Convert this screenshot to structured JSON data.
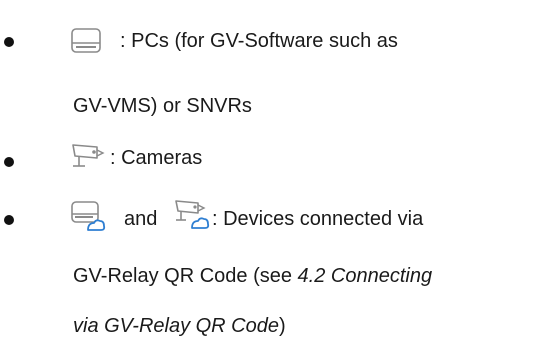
{
  "items": [
    {
      "icons": [
        "pc-icon"
      ],
      "lines": [
        ": PCs (for GV-Software such as",
        "GV-VMS) or SNVRs"
      ]
    },
    {
      "icons": [
        "camera-icon"
      ],
      "lines": [
        ": Cameras"
      ]
    },
    {
      "icons": [
        "pc-relay-icon",
        "camera-relay-icon"
      ],
      "connector": "and",
      "lines": [
        ": Devices connected via",
        "GV-Relay QR Code (see ",
        "4.2 Connecting",
        "via GV-Relay QR Code",
        ")"
      ]
    }
  ],
  "colors": {
    "text": "#1a1a1a",
    "icon_gray": "#8a8a8a",
    "relay_blue": "#2f7fd2"
  }
}
